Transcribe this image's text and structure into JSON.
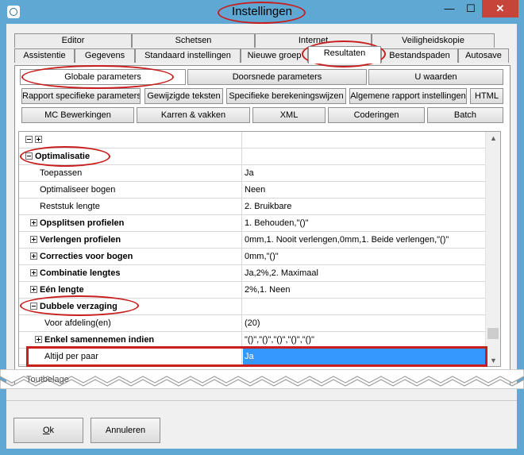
{
  "window": {
    "title": "Instellingen",
    "minimize_glyph": "—",
    "maximize_glyph": "☐",
    "close_glyph": "✕"
  },
  "tabs_row1": [
    "Editor",
    "Schetsen",
    "Internet",
    "Veiligheidskopie"
  ],
  "tabs_row2": [
    "Assistentie",
    "Gegevens",
    "Standaard instellingen",
    "Nieuwe groep",
    "Resultaten",
    "Bestandspaden",
    "Autosave"
  ],
  "active_tab": "Resultaten",
  "subtabs_row1": [
    "Globale parameters",
    "Doorsnede parameters",
    "U waarden"
  ],
  "subtabs_row2": [
    "Rapport specifieke parameters",
    "Gewijzigde teksten",
    "Specifieke berekeningswijzen",
    "Algemene rapport instellingen",
    "HTML"
  ],
  "subtabs_row3": [
    "MC Bewerkingen",
    "Karren & vakken",
    "XML",
    "Coderingen",
    "Batch"
  ],
  "grid": {
    "rows": [
      {
        "name": "Optimalisatie",
        "value": "",
        "group": true,
        "expanded": true,
        "indent": 0
      },
      {
        "name": "Toepassen",
        "value": "Ja",
        "group": false,
        "indent": 1
      },
      {
        "name": "Optimaliseer bogen",
        "value": "Neen",
        "group": false,
        "indent": 1
      },
      {
        "name": "Reststuk lengte",
        "value": "2. Bruikbare",
        "group": false,
        "indent": 1
      },
      {
        "name": "Opsplitsen profielen",
        "value": "1. Behouden,\"()\"",
        "group": true,
        "expanded": false,
        "indent": 1
      },
      {
        "name": "Verlengen profielen",
        "value": "0mm,1. Nooit verlengen,0mm,1. Beide verlengen,\"()\"",
        "group": true,
        "expanded": false,
        "indent": 1
      },
      {
        "name": "Correcties voor bogen",
        "value": "0mm,\"()\"",
        "group": true,
        "expanded": false,
        "indent": 1
      },
      {
        "name": "Combinatie lengtes",
        "value": "Ja,2%,2. Maximaal",
        "group": true,
        "expanded": false,
        "indent": 1
      },
      {
        "name": "Eén lengte",
        "value": "2%,1. Neen",
        "group": true,
        "expanded": false,
        "indent": 1
      },
      {
        "name": "Dubbele verzaging",
        "value": "",
        "group": true,
        "expanded": true,
        "indent": 1
      },
      {
        "name": "Voor afdeling(en)",
        "value": "(20)",
        "group": false,
        "indent": 2
      },
      {
        "name": "Enkel samennemen indien",
        "value": "\"()\",\"()\",\"()\",\"()\",\"()\"",
        "group": true,
        "expanded": false,
        "indent": 2
      },
      {
        "name": "Altijd per paar",
        "value": "Ja",
        "group": false,
        "indent": 2,
        "selected": true
      }
    ]
  },
  "footer_partial": "Toutbelage",
  "buttons": {
    "ok_accel": "O",
    "ok_rest": "k",
    "cancel": "Annuleren"
  },
  "colors": {
    "title_bar": "#5fa8d3",
    "selection": "#3399ff",
    "highlight": "#c81e1e",
    "close": "#c7443a"
  }
}
